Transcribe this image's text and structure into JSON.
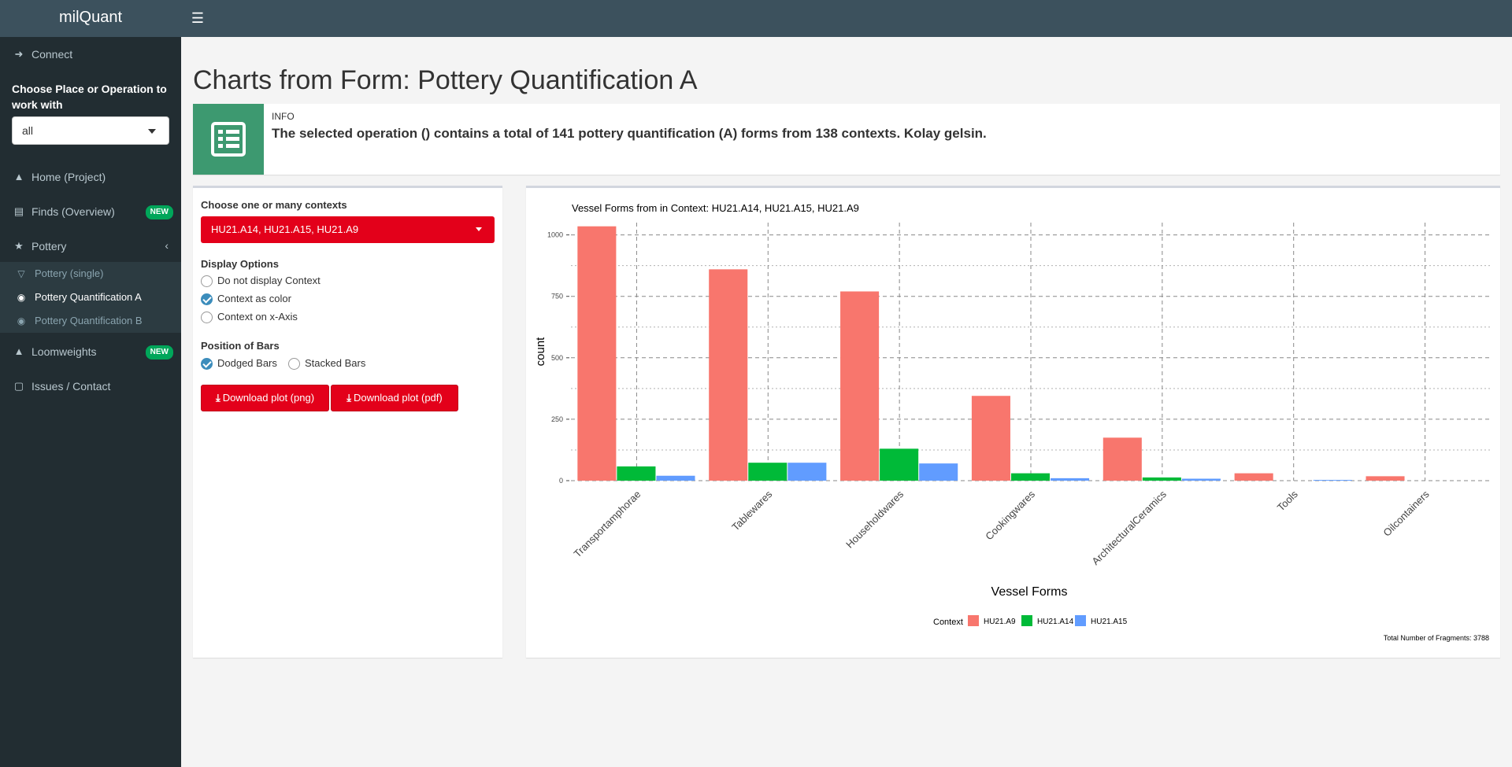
{
  "header": {
    "app_name": "milQuant",
    "menu_icon": "hamburger-icon"
  },
  "sidebar": {
    "connect": {
      "label": "Connect",
      "icon": "sign-in-icon"
    },
    "place_label": "Choose Place or Operation to work with",
    "place_value": "all",
    "items": [
      {
        "label": "Home (Project)",
        "icon": "graduation-cap-icon"
      },
      {
        "label": "Finds (Overview)",
        "icon": "bar-chart-icon",
        "badge": "NEW"
      },
      {
        "label": "Pottery",
        "icon": "trophy-icon"
      },
      {
        "label": "Loomweights",
        "icon": "weight-icon",
        "badge": "NEW"
      },
      {
        "label": "Issues / Contact",
        "icon": "file-icon"
      }
    ],
    "pottery_sub": [
      {
        "label": "Pottery (single)",
        "icon": "wine-glass-icon"
      },
      {
        "label": "Pottery Quantification A",
        "icon": "glasses-icon"
      },
      {
        "label": "Pottery Quantification B",
        "icon": "glasses-icon"
      }
    ]
  },
  "main": {
    "title": "Charts from Form: Pottery Quantification A",
    "info": {
      "title": "INFO",
      "text": "The selected operation () contains a total of 141 pottery quantification (A) forms from 138 contexts. Kolay gelsin."
    }
  },
  "controls": {
    "contexts_label": "Choose one or many contexts",
    "contexts_value": "HU21.A14, HU21.A15, HU21.A9",
    "display_label": "Display Options",
    "display_options": [
      {
        "label": "Do not display Context",
        "checked": false
      },
      {
        "label": "Context as color",
        "checked": true
      },
      {
        "label": "Context on x-Axis",
        "checked": false
      }
    ],
    "bars_label": "Position of Bars",
    "bar_options": [
      {
        "label": "Dodged Bars",
        "checked": true
      },
      {
        "label": "Stacked Bars",
        "checked": false
      }
    ],
    "download_png": "Download plot (png)",
    "download_pdf": "Download plot (pdf)"
  },
  "chart_data": {
    "type": "bar",
    "title": "Vessel Forms from  in Context: HU21.A14, HU21.A15, HU21.A9",
    "xlabel": "Vessel Forms",
    "ylabel": "count",
    "ylim": [
      0,
      1000
    ],
    "yticks": [
      0,
      250,
      500,
      750,
      1000
    ],
    "categories": [
      "Transportamphorae",
      "Tablewares",
      "Householdwares",
      "Cookingwares",
      "ArchitecturalCeramics",
      "Tools",
      "Oilcontainers"
    ],
    "series": [
      {
        "name": "HU21.A9",
        "color": "#f8766d",
        "values": [
          1035,
          860,
          770,
          345,
          175,
          30,
          18
        ]
      },
      {
        "name": "HU21.A14",
        "color": "#00ba38",
        "values": [
          58,
          73,
          130,
          30,
          13,
          0,
          0
        ]
      },
      {
        "name": "HU21.A15",
        "color": "#619cff",
        "values": [
          20,
          73,
          70,
          10,
          8,
          3,
          0
        ]
      }
    ],
    "legend_title": "Context",
    "legend_position": "bottom",
    "grid": true,
    "caption": "Total Number of Fragments: 3788"
  }
}
